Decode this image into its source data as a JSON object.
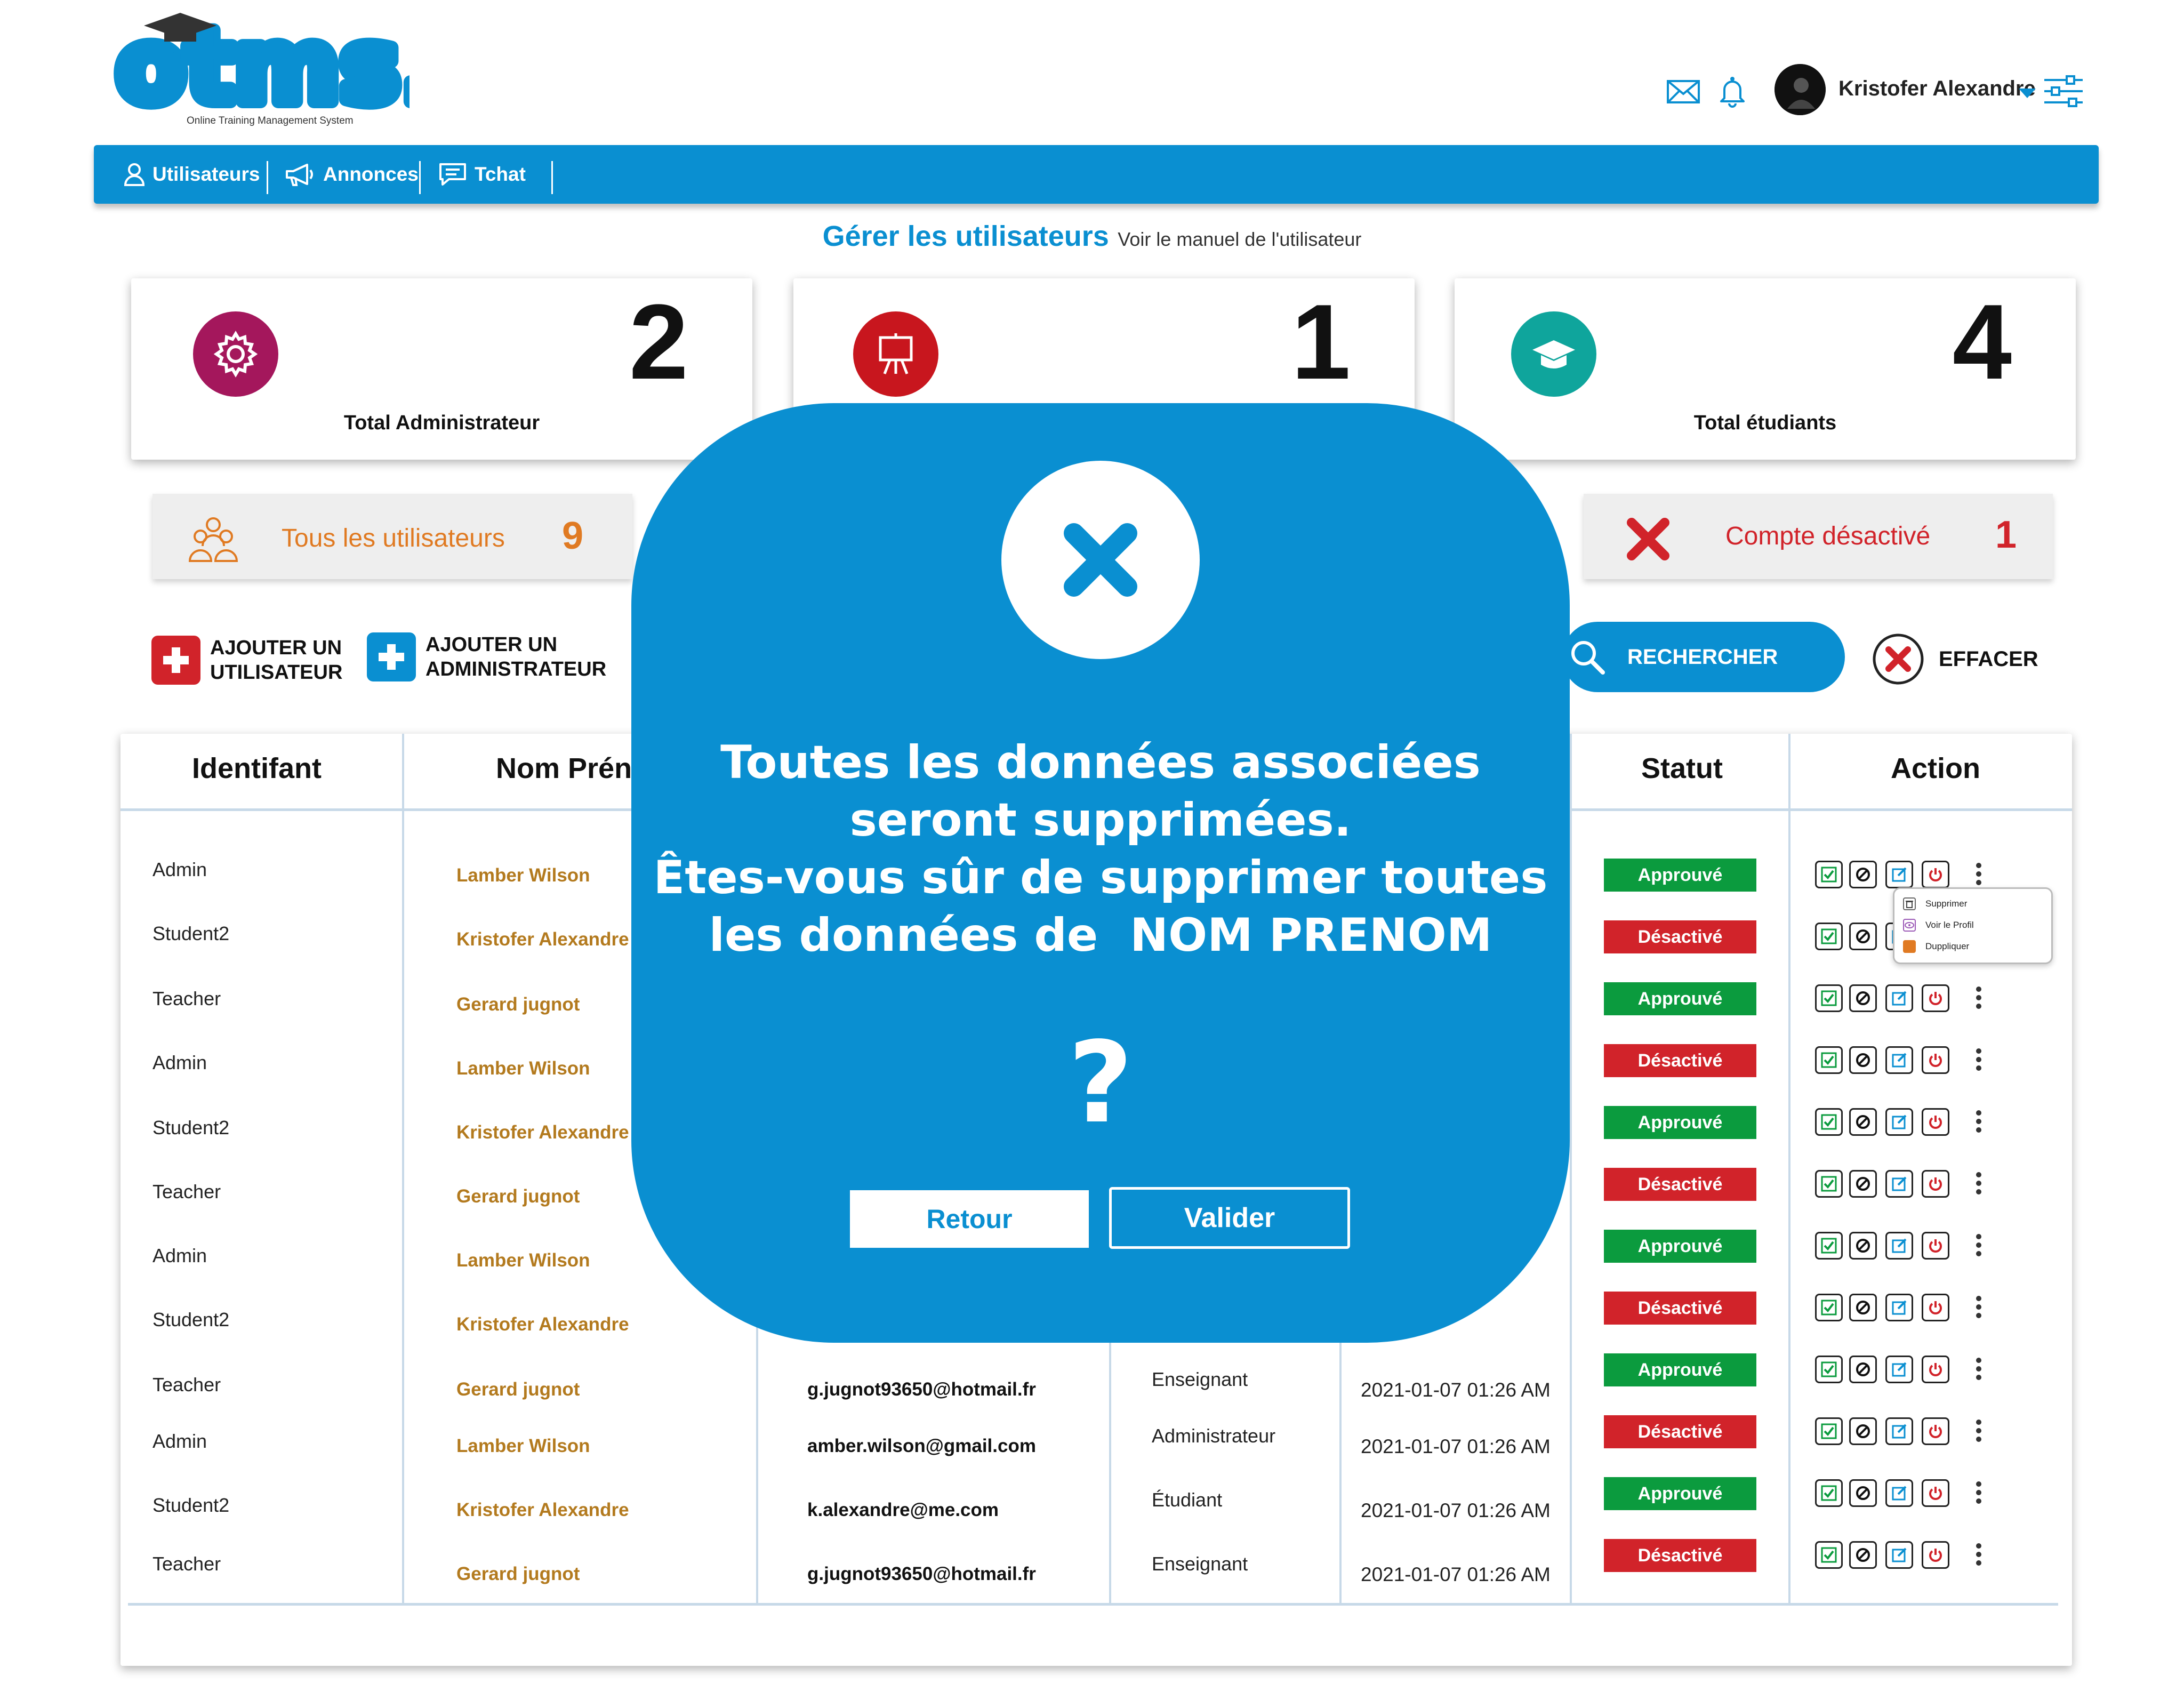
{
  "logo": {
    "text": "otms",
    "tagline": "Online Training Management System"
  },
  "header": {
    "icons": [
      "mail-icon",
      "bell-icon",
      "filter-settings-icon"
    ],
    "user_name": "Kristofer Alexandre"
  },
  "nav": {
    "items": [
      {
        "label": "Utilisateurs",
        "icon": "user-icon"
      },
      {
        "label": "Annonces",
        "icon": "megaphone-icon"
      },
      {
        "label": "Tchat",
        "icon": "chat-icon"
      }
    ]
  },
  "page": {
    "title": "Gérer les utilisateurs",
    "manual_link": "Voir le manuel de l'utilisateur"
  },
  "stats": [
    {
      "label": "Total Administrateur",
      "value": "2",
      "icon": "gear-icon",
      "color": "#a4175c"
    },
    {
      "label": "",
      "value": "1",
      "icon": "presentation-board-icon",
      "color": "#c8161e"
    },
    {
      "label": "Total étudiants",
      "value": "4",
      "icon": "graduation-cap-icon",
      "color": "#0fa59c"
    }
  ],
  "filters": {
    "all": {
      "label": "Tous les utilisateurs",
      "count": "9",
      "color": "#e07a22"
    },
    "disabled": {
      "label": "Compte désactivé",
      "count": "1",
      "color": "#d1232a"
    }
  },
  "actions": {
    "add_user": {
      "line1": "AJOUTER UN",
      "line2": "UTILISATEUR",
      "color": "#d1232a"
    },
    "add_admin": {
      "line1": "AJOUTER UN",
      "line2": "ADMINISTRATEUR",
      "color": "#0a8fd1"
    },
    "search": "RECHERCHER",
    "clear": "EFFACER"
  },
  "table": {
    "headers": {
      "id": "Identifant",
      "name": "Nom Prén",
      "status": "Statut",
      "action": "Action"
    },
    "rows": [
      {
        "id": "Admin",
        "name": "Lamber Wilson",
        "email": "",
        "role": "",
        "date": "",
        "status": "Approuvé"
      },
      {
        "id": "Student2",
        "name": "Kristofer Alexandre",
        "email": "",
        "role": "",
        "date": "",
        "status": "Désactivé"
      },
      {
        "id": "Teacher",
        "name": "Gerard jugnot",
        "email": "",
        "role": "",
        "date": "",
        "status": "Approuvé"
      },
      {
        "id": "Admin",
        "name": "Lamber Wilson",
        "email": "",
        "role": "",
        "date": "",
        "status": "Désactivé"
      },
      {
        "id": "Student2",
        "name": "Kristofer Alexandre",
        "email": "",
        "role": "",
        "date": "",
        "status": "Approuvé"
      },
      {
        "id": "Teacher",
        "name": "Gerard jugnot",
        "email": "",
        "role": "",
        "date": "",
        "status": "Désactivé"
      },
      {
        "id": "Admin",
        "name": "Lamber Wilson",
        "email": "",
        "role": "",
        "date": "",
        "status": "Approuvé"
      },
      {
        "id": "Student2",
        "name": "Kristofer Alexandre",
        "email": "",
        "role": "",
        "date": ":26 AM",
        "status": "Désactivé"
      },
      {
        "id": "Teacher",
        "name": "Gerard jugnot",
        "email": "g.jugnot93650@hotmail.fr",
        "role": "Enseignant",
        "date": "2021-01-07 01:26 AM",
        "status": "Approuvé"
      },
      {
        "id": "Admin",
        "name": "Lamber Wilson",
        "email": "amber.wilson@gmail.com",
        "role": "Administrateur",
        "date": "2021-01-07 01:26 AM",
        "status": "Désactivé"
      },
      {
        "id": "Student2",
        "name": "Kristofer Alexandre",
        "email": "k.alexandre@me.com",
        "role": "Étudiant",
        "date": "2021-01-07 01:26 AM",
        "status": "Approuvé"
      },
      {
        "id": "Teacher",
        "name": "Gerard jugnot",
        "email": "g.jugnot93650@hotmail.fr",
        "role": "Enseignant",
        "date": "2021-01-07 01:26 AM",
        "status": "Désactivé"
      }
    ],
    "row_action_icons": [
      "approve-icon",
      "block-icon",
      "edit-icon",
      "power-icon",
      "more-icon"
    ]
  },
  "context_menu": {
    "items": [
      {
        "label": "Supprimer",
        "icon": "trash-icon"
      },
      {
        "label": "Voir le Profil",
        "icon": "eye-icon"
      },
      {
        "label": "Duppliquer",
        "icon": "duplicate-icon"
      }
    ]
  },
  "modal": {
    "line1": "Toutes les données associées",
    "line2": "seront supprimées.",
    "line3": "Êtes-vous sûr de supprimer toutes",
    "line4": "les données de  NOM PRENOM",
    "question_mark": "?",
    "back_label": "Retour",
    "confirm_label": "Valider"
  }
}
